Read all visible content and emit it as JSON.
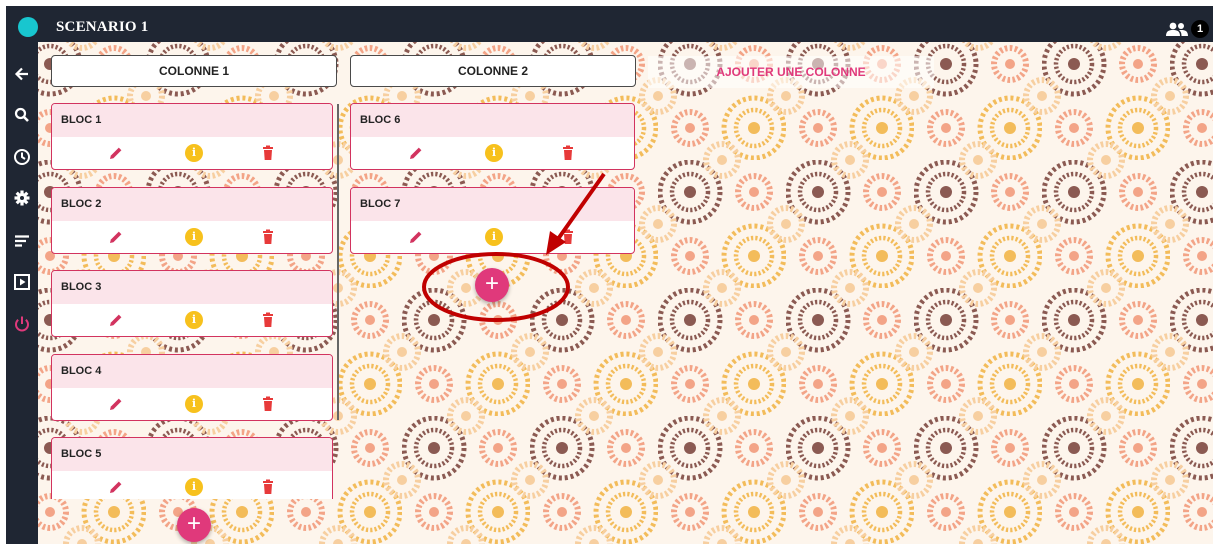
{
  "app": {
    "title": "SCENARIO 1",
    "user_count": "1"
  },
  "board": {
    "add_column_label": "AJOUTER UNE COLONNE",
    "add_bloc_label": "+"
  },
  "columns": [
    {
      "title": "COLONNE 1",
      "blocs": [
        "BLOC 1",
        "BLOC 2",
        "BLOC 3",
        "BLOC 4",
        "BLOC 5"
      ]
    },
    {
      "title": "COLONNE 2",
      "blocs": [
        "BLOC 6",
        "BLOC 7"
      ]
    }
  ],
  "colors": {
    "topbar": "#1f2633",
    "accent": "#e0397b",
    "info": "#f7c11d",
    "logo": "#18c6cf",
    "annotation": "#c00000"
  },
  "icons": {
    "bloc_actions": [
      "pencil-icon",
      "info-icon",
      "trash-icon"
    ],
    "info_glyph": "i"
  }
}
